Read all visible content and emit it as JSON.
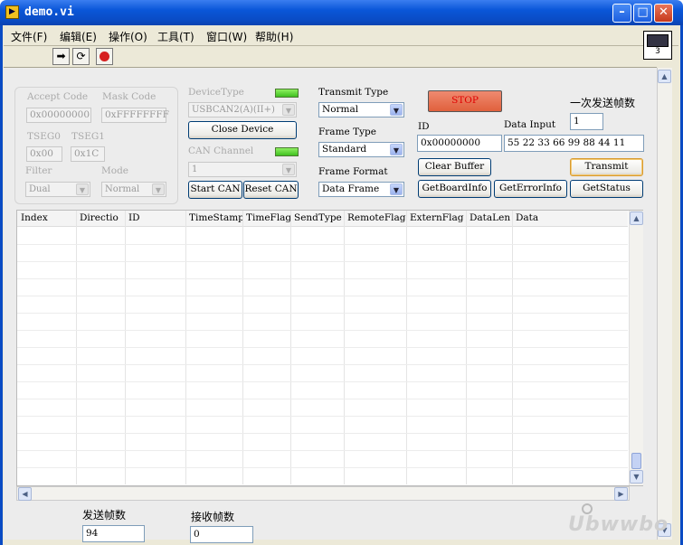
{
  "window": {
    "title": "demo.vi",
    "icon_text": "▶"
  },
  "menu": [
    "文件(F)",
    "编辑(E)",
    "操作(O)",
    "工具(T)",
    "窗口(W)",
    "帮助(H)"
  ],
  "toolbar": {
    "run": "run-icon",
    "run_continuous": "run-continuously-icon",
    "abort": "abort-icon"
  },
  "vi_icon_number": "3",
  "config": {
    "accept_code_label": "Accept Code",
    "accept_code": "0x00000000",
    "mask_code_label": "Mask Code",
    "mask_code": "0xFFFFFFFF",
    "tseg0_label": "TSEG0",
    "tseg0": "0x00",
    "tseg1_label": "TSEG1",
    "tseg1": "0x1C",
    "filter_label": "Filter",
    "filter": "Dual",
    "mode_label": "Mode",
    "mode": "Normal"
  },
  "device": {
    "device_type_label": "DeviceType",
    "device_type": "USBCAN2(A)(II+)",
    "close_device": "Close Device",
    "can_channel_label": "CAN Channel",
    "can_channel": "1",
    "start_can": "Start CAN",
    "reset_can": "Reset CAN"
  },
  "transmit": {
    "transmit_type_label": "Transmit Type",
    "transmit_type": "Normal",
    "frame_type_label": "Frame Type",
    "frame_type": "Standard",
    "frame_format_label": "Frame Format",
    "frame_format": "Data Frame"
  },
  "actions": {
    "stop": "STOP",
    "send_count_label": "一次发送帧数",
    "send_count": "1",
    "id_label": "ID",
    "id": "0x00000000",
    "data_input_label": "Data Input",
    "data_input": "55 22 33 66 99 88 44 11",
    "clear_buffer": "Clear Buffer",
    "transmit": "Transmit",
    "get_board_info": "GetBoardInfo",
    "get_error_info": "GetErrorInfo",
    "get_status": "GetStatus"
  },
  "table": {
    "columns": [
      "Index",
      "Directio",
      "ID",
      "TimeStamp",
      "TimeFlag",
      "SendType",
      "RemoteFlag",
      "ExternFlag",
      "DataLen",
      "Data"
    ]
  },
  "counters": {
    "sent_label": "发送帧数",
    "sent": "94",
    "recv_label": "接收帧数",
    "recv": "0"
  },
  "watermark": "Ubwwbo",
  "colors": {
    "titlebar": "#0a4bc4",
    "stop_text": "#e00000",
    "led": "#5ed83a"
  }
}
